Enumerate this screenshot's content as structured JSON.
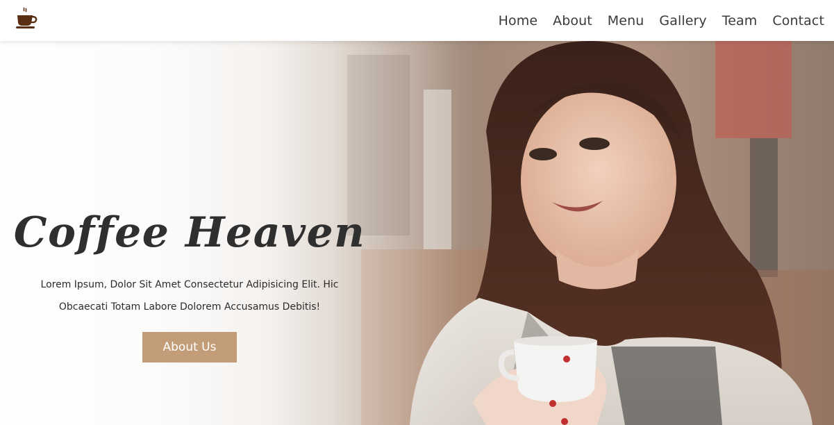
{
  "nav": {
    "logo_icon": "coffee-cup-icon",
    "links": [
      {
        "label": "Home"
      },
      {
        "label": "About"
      },
      {
        "label": "Menu"
      },
      {
        "label": "Gallery"
      },
      {
        "label": "Team"
      },
      {
        "label": "Contact"
      }
    ]
  },
  "hero": {
    "title": "Coffee Heaven",
    "text_line1": "Lorem Ipsum, Dolor Sit Amet Consectetur Adipisicing Elit. Hic",
    "text_line2": "Obcaecati Totam Labore Dolorem Accusamus Debitis!",
    "button_label": "About Us",
    "image_icon": "woman-holding-coffee-cup-photo"
  },
  "colors": {
    "accent": "#c39d78",
    "logo_brown": "#5a2e12",
    "text_dark": "#2f2f2f"
  }
}
